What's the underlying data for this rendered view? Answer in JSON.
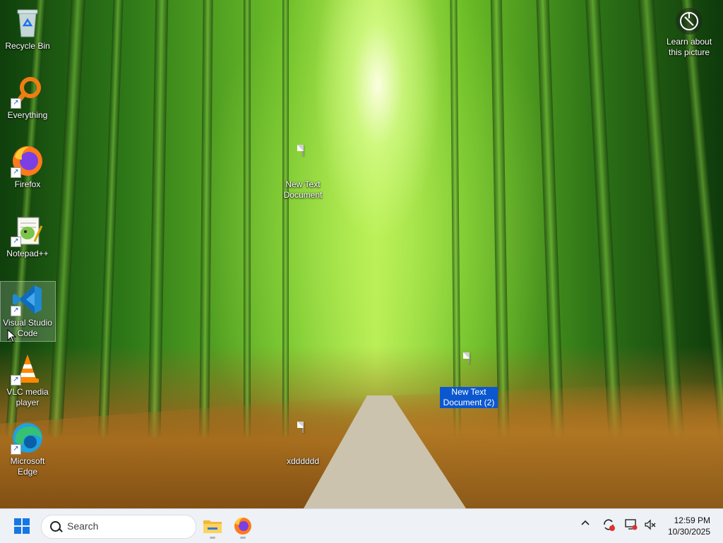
{
  "desktop": {
    "icons": [
      {
        "label": "Recycle Bin",
        "icon": "recycle-bin-icon"
      },
      {
        "label": "Everything",
        "icon": "everything-search-icon"
      },
      {
        "label": "Firefox",
        "icon": "firefox-icon"
      },
      {
        "label": "Notepad++",
        "icon": "notepad-plus-plus-icon"
      },
      {
        "label": "Visual Studio Code",
        "icon": "vscode-icon"
      },
      {
        "label": "VLC media player",
        "icon": "vlc-icon"
      },
      {
        "label": "Microsoft Edge",
        "icon": "edge-icon"
      }
    ],
    "files": [
      {
        "label": "New Text Document",
        "icon": "text-file-icon"
      },
      {
        "label": "New Text Document (2)",
        "icon": "text-file-icon",
        "selected": true
      },
      {
        "label": "xdddddd",
        "icon": "text-file-icon"
      }
    ],
    "learn_about": "Learn about this picture"
  },
  "taskbar": {
    "search_placeholder": "Search",
    "apps": [
      "file-explorer-icon",
      "firefox-icon"
    ],
    "tray": [
      "chevron-up-icon",
      "update-icon",
      "display-icon",
      "volume-muted-icon"
    ],
    "time": "12:59 PM",
    "date": "10/30/2025"
  },
  "colors": {
    "accent": "#0b57d0",
    "start": "#1677e4",
    "taskbar": "#eef1f6"
  }
}
